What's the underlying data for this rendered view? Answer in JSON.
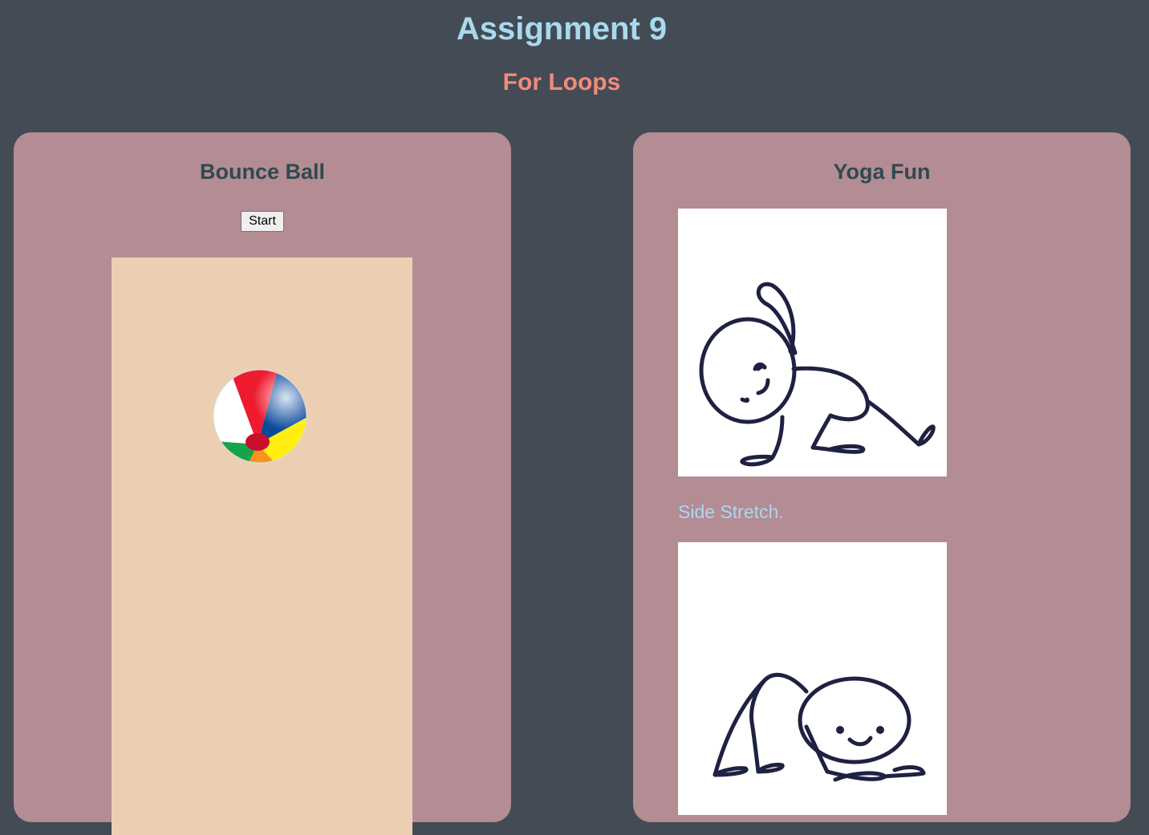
{
  "header": {
    "title": "Assignment 9",
    "subtitle": "For Loops"
  },
  "bounce_panel": {
    "title": "Bounce Ball",
    "start_label": "Start",
    "ball_icon": "beach-ball-icon"
  },
  "yoga_panel": {
    "title": "Yoga Fun",
    "poses": [
      {
        "image": "side-stretch-figure-icon",
        "caption": "Side Stretch."
      },
      {
        "image": "crawl-pose-figure-icon"
      }
    ]
  },
  "colors": {
    "page_background": "#434b55",
    "title": "#a9d9ef",
    "subtitle": "#f48a78",
    "panel_background": "#b38c94",
    "panel_title": "#2f4a4f",
    "court_background": "#eccfb2",
    "caption": "#a9d9ef",
    "figure_stroke": "#1e2142"
  }
}
